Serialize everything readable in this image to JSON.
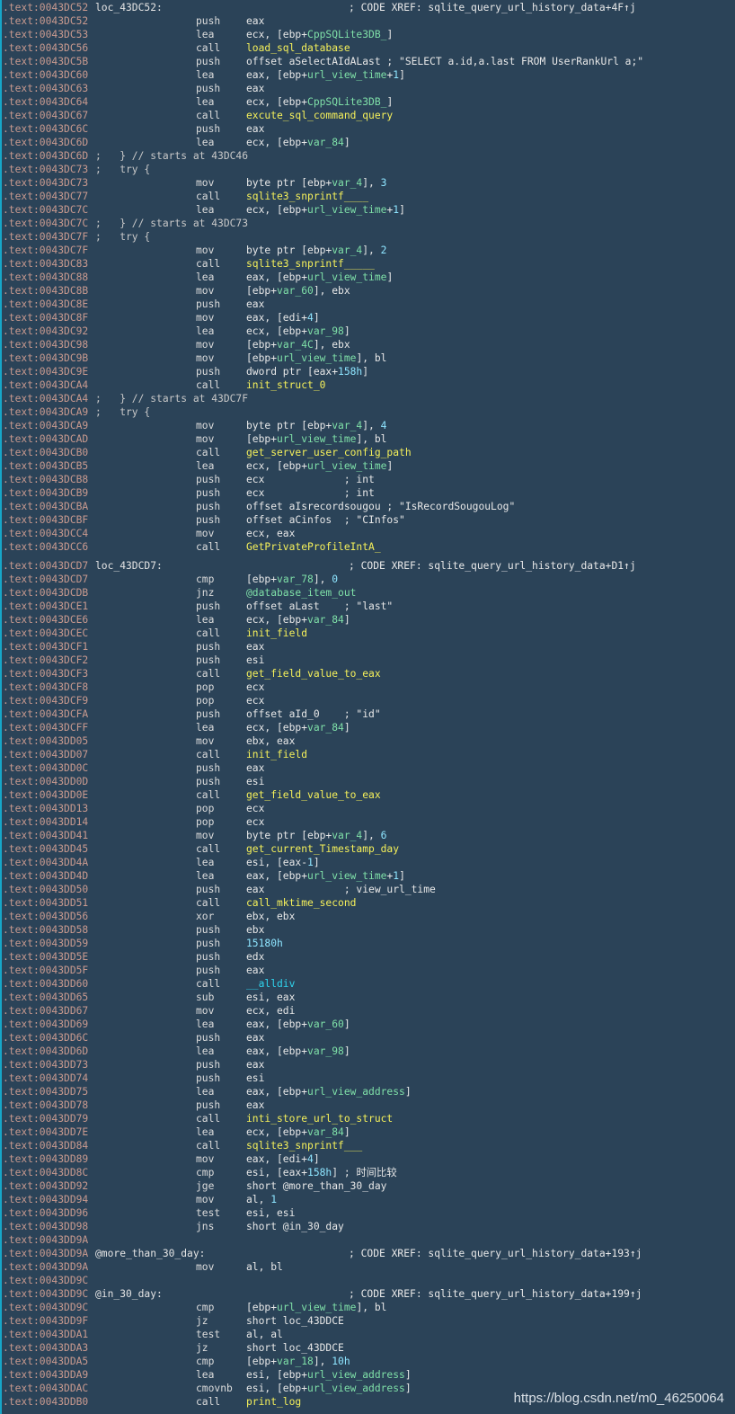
{
  "watermark": "https://blog.csdn.net/m0_46250064",
  "colors": {
    "background": "#2b4358",
    "address": "#c99a8f",
    "function": "#f5f05a",
    "variable": "#7fe0a8",
    "number": "#8ee5ff",
    "library": "#2fd4ee"
  },
  "lines": [
    {
      "addr": ".text:0043DC52",
      "label": "loc_43DC52:",
      "xref": "; CODE XREF: sqlite_query_url_history_data+4F↑j"
    },
    {
      "addr": ".text:0043DC52",
      "m": "push",
      "ops": [
        [
          "eax"
        ]
      ]
    },
    {
      "addr": ".text:0043DC53",
      "m": "lea",
      "ops": [
        [
          "ecx, [ebp+"
        ],
        [
          "CppSQLite3DB_",
          "v"
        ],
        [
          "]"
        ]
      ]
    },
    {
      "addr": ".text:0043DC56",
      "m": "call",
      "ops": [
        [
          "load_sql_database",
          "f"
        ]
      ]
    },
    {
      "addr": ".text:0043DC5B",
      "m": "push",
      "ops": [
        [
          "offset aSelectAIdALast ; \"SELECT a.id,a.last FROM UserRankUrl a;\""
        ]
      ]
    },
    {
      "addr": ".text:0043DC60",
      "m": "lea",
      "ops": [
        [
          "eax, [ebp+"
        ],
        [
          "url_view_time",
          "v"
        ],
        [
          "+"
        ],
        [
          "1",
          "n"
        ],
        [
          "]"
        ]
      ]
    },
    {
      "addr": ".text:0043DC63",
      "m": "push",
      "ops": [
        [
          "eax"
        ]
      ]
    },
    {
      "addr": ".text:0043DC64",
      "m": "lea",
      "ops": [
        [
          "ecx, [ebp+"
        ],
        [
          "CppSQLite3DB_",
          "v"
        ],
        [
          "]"
        ]
      ]
    },
    {
      "addr": ".text:0043DC67",
      "m": "call",
      "ops": [
        [
          "excute_sql_command_query",
          "f"
        ]
      ]
    },
    {
      "addr": ".text:0043DC6C",
      "m": "push",
      "ops": [
        [
          "eax"
        ]
      ]
    },
    {
      "addr": ".text:0043DC6D",
      "m": "lea",
      "ops": [
        [
          "ecx, [ebp+"
        ],
        [
          "var_84",
          "v"
        ],
        [
          "]"
        ]
      ]
    },
    {
      "addr": ".text:0043DC6D",
      "block": ";   } // starts at 43DC46"
    },
    {
      "addr": ".text:0043DC73",
      "block": ";   try {"
    },
    {
      "addr": ".text:0043DC73",
      "m": "mov",
      "ops": [
        [
          "byte ptr [ebp+"
        ],
        [
          "var_4",
          "v"
        ],
        [
          "], "
        ],
        [
          "3",
          "n"
        ]
      ]
    },
    {
      "addr": ".text:0043DC77",
      "m": "call",
      "ops": [
        [
          "sqlite3_snprintf____",
          "f"
        ]
      ]
    },
    {
      "addr": ".text:0043DC7C",
      "m": "lea",
      "ops": [
        [
          "ecx, [ebp+"
        ],
        [
          "url_view_time",
          "v"
        ],
        [
          "+"
        ],
        [
          "1",
          "n"
        ],
        [
          "]"
        ]
      ]
    },
    {
      "addr": ".text:0043DC7C",
      "block": ";   } // starts at 43DC73"
    },
    {
      "addr": ".text:0043DC7F",
      "block": ";   try {"
    },
    {
      "addr": ".text:0043DC7F",
      "m": "mov",
      "ops": [
        [
          "byte ptr [ebp+"
        ],
        [
          "var_4",
          "v"
        ],
        [
          "], "
        ],
        [
          "2",
          "n"
        ]
      ]
    },
    {
      "addr": ".text:0043DC83",
      "m": "call",
      "ops": [
        [
          "sqlite3_snprintf_____",
          "f"
        ]
      ]
    },
    {
      "addr": ".text:0043DC88",
      "m": "lea",
      "ops": [
        [
          "eax, [ebp+"
        ],
        [
          "url_view_time",
          "v"
        ],
        [
          "]"
        ]
      ]
    },
    {
      "addr": ".text:0043DC8B",
      "m": "mov",
      "ops": [
        [
          "[ebp+"
        ],
        [
          "var_60",
          "v"
        ],
        [
          "], ebx"
        ]
      ]
    },
    {
      "addr": ".text:0043DC8E",
      "m": "push",
      "ops": [
        [
          "eax"
        ]
      ]
    },
    {
      "addr": ".text:0043DC8F",
      "m": "mov",
      "ops": [
        [
          "eax, [edi+"
        ],
        [
          "4",
          "n"
        ],
        [
          "]"
        ]
      ]
    },
    {
      "addr": ".text:0043DC92",
      "m": "lea",
      "ops": [
        [
          "ecx, [ebp+"
        ],
        [
          "var_98",
          "v"
        ],
        [
          "]"
        ]
      ]
    },
    {
      "addr": ".text:0043DC98",
      "m": "mov",
      "ops": [
        [
          "[ebp+"
        ],
        [
          "var_4C",
          "v"
        ],
        [
          "], ebx"
        ]
      ]
    },
    {
      "addr": ".text:0043DC9B",
      "m": "mov",
      "ops": [
        [
          "[ebp+"
        ],
        [
          "url_view_time",
          "v"
        ],
        [
          "], bl"
        ]
      ]
    },
    {
      "addr": ".text:0043DC9E",
      "m": "push",
      "ops": [
        [
          "dword ptr [eax+"
        ],
        [
          "158h",
          "n"
        ],
        [
          "]"
        ]
      ]
    },
    {
      "addr": ".text:0043DCA4",
      "m": "call",
      "ops": [
        [
          "init_struct_0",
          "f"
        ]
      ]
    },
    {
      "addr": ".text:0043DCA4",
      "block": ";   } // starts at 43DC7F"
    },
    {
      "addr": ".text:0043DCA9",
      "block": ";   try {"
    },
    {
      "addr": ".text:0043DCA9",
      "m": "mov",
      "ops": [
        [
          "byte ptr [ebp+"
        ],
        [
          "var_4",
          "v"
        ],
        [
          "], "
        ],
        [
          "4",
          "n"
        ]
      ]
    },
    {
      "addr": ".text:0043DCAD",
      "m": "mov",
      "ops": [
        [
          "[ebp+"
        ],
        [
          "url_view_time",
          "v"
        ],
        [
          "], bl"
        ]
      ]
    },
    {
      "addr": ".text:0043DCB0",
      "m": "call",
      "ops": [
        [
          "get_server_user_config_path",
          "f"
        ]
      ]
    },
    {
      "addr": ".text:0043DCB5",
      "m": "lea",
      "ops": [
        [
          "ecx, [ebp+"
        ],
        [
          "url_view_time",
          "v"
        ],
        [
          "]"
        ]
      ]
    },
    {
      "addr": ".text:0043DCB8",
      "m": "push",
      "ops": [
        [
          "ecx             ; int"
        ]
      ]
    },
    {
      "addr": ".text:0043DCB9",
      "m": "push",
      "ops": [
        [
          "ecx             ; int"
        ]
      ]
    },
    {
      "addr": ".text:0043DCBA",
      "m": "push",
      "ops": [
        [
          "offset aIsrecordsougou ; \"IsRecordSougouLog\""
        ]
      ]
    },
    {
      "addr": ".text:0043DCBF",
      "m": "push",
      "ops": [
        [
          "offset aCinfos  ; \"CInfos\""
        ]
      ]
    },
    {
      "addr": ".text:0043DCC4",
      "m": "mov",
      "ops": [
        [
          "ecx, eax"
        ]
      ]
    },
    {
      "addr": ".text:0043DCC6",
      "m": "call",
      "ops": [
        [
          "GetPrivateProfileIntA_",
          "f"
        ]
      ]
    },
    {
      "addr": ".text:0043DCD7",
      "label": "loc_43DCD7:",
      "xref": "; CODE XREF: sqlite_query_url_history_data+D1↑j",
      "gap": true
    },
    {
      "addr": ".text:0043DCD7",
      "m": "cmp",
      "ops": [
        [
          "[ebp+"
        ],
        [
          "var_78",
          "v"
        ],
        [
          "], "
        ],
        [
          "0",
          "n"
        ]
      ]
    },
    {
      "addr": ".text:0043DCDB",
      "m": "jnz",
      "ops": [
        [
          "@database_item_out",
          "v"
        ]
      ]
    },
    {
      "addr": ".text:0043DCE1",
      "m": "push",
      "ops": [
        [
          "offset aLast    ; \"last\""
        ]
      ]
    },
    {
      "addr": ".text:0043DCE6",
      "m": "lea",
      "ops": [
        [
          "ecx, [ebp+"
        ],
        [
          "var_84",
          "v"
        ],
        [
          "]"
        ]
      ]
    },
    {
      "addr": ".text:0043DCEC",
      "m": "call",
      "ops": [
        [
          "init_field",
          "f"
        ]
      ]
    },
    {
      "addr": ".text:0043DCF1",
      "m": "push",
      "ops": [
        [
          "eax"
        ]
      ]
    },
    {
      "addr": ".text:0043DCF2",
      "m": "push",
      "ops": [
        [
          "esi"
        ]
      ]
    },
    {
      "addr": ".text:0043DCF3",
      "m": "call",
      "ops": [
        [
          "get_field_value_to_eax",
          "f"
        ]
      ]
    },
    {
      "addr": ".text:0043DCF8",
      "m": "pop",
      "ops": [
        [
          "ecx"
        ]
      ]
    },
    {
      "addr": ".text:0043DCF9",
      "m": "pop",
      "ops": [
        [
          "ecx"
        ]
      ]
    },
    {
      "addr": ".text:0043DCFA",
      "m": "push",
      "ops": [
        [
          "offset aId_0    ; \"id\""
        ]
      ]
    },
    {
      "addr": ".text:0043DCFF",
      "m": "lea",
      "ops": [
        [
          "ecx, [ebp+"
        ],
        [
          "var_84",
          "v"
        ],
        [
          "]"
        ]
      ]
    },
    {
      "addr": ".text:0043DD05",
      "m": "mov",
      "ops": [
        [
          "ebx, eax"
        ]
      ]
    },
    {
      "addr": ".text:0043DD07",
      "m": "call",
      "ops": [
        [
          "init_field",
          "f"
        ]
      ]
    },
    {
      "addr": ".text:0043DD0C",
      "m": "push",
      "ops": [
        [
          "eax"
        ]
      ]
    },
    {
      "addr": ".text:0043DD0D",
      "m": "push",
      "ops": [
        [
          "esi"
        ]
      ]
    },
    {
      "addr": ".text:0043DD0E",
      "m": "call",
      "ops": [
        [
          "get_field_value_to_eax",
          "f"
        ]
      ]
    },
    {
      "addr": ".text:0043DD13",
      "m": "pop",
      "ops": [
        [
          "ecx"
        ]
      ]
    },
    {
      "addr": ".text:0043DD14",
      "m": "pop",
      "ops": [
        [
          "ecx"
        ]
      ]
    },
    {
      "addr": ".text:0043DD41",
      "m": "mov",
      "ops": [
        [
          "byte ptr [ebp+"
        ],
        [
          "var_4",
          "v"
        ],
        [
          "], "
        ],
        [
          "6",
          "n"
        ]
      ]
    },
    {
      "addr": ".text:0043DD45",
      "m": "call",
      "ops": [
        [
          "get_current_Timestamp_day",
          "f"
        ]
      ]
    },
    {
      "addr": ".text:0043DD4A",
      "m": "lea",
      "ops": [
        [
          "esi, [eax-"
        ],
        [
          "1",
          "n"
        ],
        [
          "]"
        ]
      ]
    },
    {
      "addr": ".text:0043DD4D",
      "m": "lea",
      "ops": [
        [
          "eax, [ebp+"
        ],
        [
          "url_view_time",
          "v"
        ],
        [
          "+"
        ],
        [
          "1",
          "n"
        ],
        [
          "]"
        ]
      ]
    },
    {
      "addr": ".text:0043DD50",
      "m": "push",
      "ops": [
        [
          "eax             ; view_url_time"
        ]
      ]
    },
    {
      "addr": ".text:0043DD51",
      "m": "call",
      "ops": [
        [
          "call_mktime_second",
          "f"
        ]
      ]
    },
    {
      "addr": ".text:0043DD56",
      "m": "xor",
      "ops": [
        [
          "ebx, ebx"
        ]
      ]
    },
    {
      "addr": ".text:0043DD58",
      "m": "push",
      "ops": [
        [
          "ebx"
        ]
      ]
    },
    {
      "addr": ".text:0043DD59",
      "m": "push",
      "ops": [
        [
          "15180h",
          "n"
        ]
      ]
    },
    {
      "addr": ".text:0043DD5E",
      "m": "push",
      "ops": [
        [
          "edx"
        ]
      ]
    },
    {
      "addr": ".text:0043DD5F",
      "m": "push",
      "ops": [
        [
          "eax"
        ]
      ]
    },
    {
      "addr": ".text:0043DD60",
      "m": "call",
      "ops": [
        [
          "__alldiv",
          "s"
        ]
      ]
    },
    {
      "addr": ".text:0043DD65",
      "m": "sub",
      "ops": [
        [
          "esi, eax"
        ]
      ]
    },
    {
      "addr": ".text:0043DD67",
      "m": "mov",
      "ops": [
        [
          "ecx, edi"
        ]
      ]
    },
    {
      "addr": ".text:0043DD69",
      "m": "lea",
      "ops": [
        [
          "eax, [ebp+"
        ],
        [
          "var_60",
          "v"
        ],
        [
          "]"
        ]
      ]
    },
    {
      "addr": ".text:0043DD6C",
      "m": "push",
      "ops": [
        [
          "eax"
        ]
      ]
    },
    {
      "addr": ".text:0043DD6D",
      "m": "lea",
      "ops": [
        [
          "eax, [ebp+"
        ],
        [
          "var_98",
          "v"
        ],
        [
          "]"
        ]
      ]
    },
    {
      "addr": ".text:0043DD73",
      "m": "push",
      "ops": [
        [
          "eax"
        ]
      ]
    },
    {
      "addr": ".text:0043DD74",
      "m": "push",
      "ops": [
        [
          "esi"
        ]
      ]
    },
    {
      "addr": ".text:0043DD75",
      "m": "lea",
      "ops": [
        [
          "eax, [ebp+"
        ],
        [
          "url_view_address",
          "v"
        ],
        [
          "]"
        ]
      ]
    },
    {
      "addr": ".text:0043DD78",
      "m": "push",
      "ops": [
        [
          "eax"
        ]
      ]
    },
    {
      "addr": ".text:0043DD79",
      "m": "call",
      "ops": [
        [
          "inti_store_url_to_struct",
          "f"
        ]
      ]
    },
    {
      "addr": ".text:0043DD7E",
      "m": "lea",
      "ops": [
        [
          "ecx, [ebp+"
        ],
        [
          "var_84",
          "v"
        ],
        [
          "]"
        ]
      ]
    },
    {
      "addr": ".text:0043DD84",
      "m": "call",
      "ops": [
        [
          "sqlite3_snprintf___",
          "f"
        ]
      ]
    },
    {
      "addr": ".text:0043DD89",
      "m": "mov",
      "ops": [
        [
          "eax, [edi+"
        ],
        [
          "4",
          "n"
        ],
        [
          "]"
        ]
      ]
    },
    {
      "addr": ".text:0043DD8C",
      "m": "cmp",
      "ops": [
        [
          "esi, [eax+"
        ],
        [
          "158h",
          "n"
        ],
        [
          "] ; 时间比较"
        ]
      ]
    },
    {
      "addr": ".text:0043DD92",
      "m": "jge",
      "ops": [
        [
          "short @more_than_30_day"
        ]
      ]
    },
    {
      "addr": ".text:0043DD94",
      "m": "mov",
      "ops": [
        [
          "al, "
        ],
        [
          "1",
          "n"
        ]
      ]
    },
    {
      "addr": ".text:0043DD96",
      "m": "test",
      "ops": [
        [
          "esi, esi"
        ]
      ]
    },
    {
      "addr": ".text:0043DD98",
      "m": "jns",
      "ops": [
        [
          "short @in_30_day"
        ]
      ]
    },
    {
      "addr": ".text:0043DD9A"
    },
    {
      "addr": ".text:0043DD9A",
      "label": "@more_than_30_day:",
      "xref": "; CODE XREF: sqlite_query_url_history_data+193↑j"
    },
    {
      "addr": ".text:0043DD9A",
      "m": "mov",
      "ops": [
        [
          "al, bl"
        ]
      ]
    },
    {
      "addr": ".text:0043DD9C"
    },
    {
      "addr": ".text:0043DD9C",
      "label": "@in_30_day:",
      "xref": "; CODE XREF: sqlite_query_url_history_data+199↑j"
    },
    {
      "addr": ".text:0043DD9C",
      "m": "cmp",
      "ops": [
        [
          "[ebp+"
        ],
        [
          "url_view_time",
          "v"
        ],
        [
          "], bl"
        ]
      ]
    },
    {
      "addr": ".text:0043DD9F",
      "m": "jz",
      "ops": [
        [
          "short loc_43DDCE"
        ]
      ]
    },
    {
      "addr": ".text:0043DDA1",
      "m": "test",
      "ops": [
        [
          "al, al"
        ]
      ]
    },
    {
      "addr": ".text:0043DDA3",
      "m": "jz",
      "ops": [
        [
          "short loc_43DDCE"
        ]
      ]
    },
    {
      "addr": ".text:0043DDA5",
      "m": "cmp",
      "ops": [
        [
          "[ebp+"
        ],
        [
          "var_18",
          "v"
        ],
        [
          "], "
        ],
        [
          "10h",
          "n"
        ]
      ]
    },
    {
      "addr": ".text:0043DDA9",
      "m": "lea",
      "ops": [
        [
          "esi, [ebp+"
        ],
        [
          "url_view_address",
          "v"
        ],
        [
          "]"
        ]
      ]
    },
    {
      "addr": ".text:0043DDAC",
      "m": "cmovnb",
      "ops": [
        [
          "esi, [ebp+"
        ],
        [
          "url_view_address",
          "v"
        ],
        [
          "]"
        ]
      ]
    },
    {
      "addr": ".text:0043DDB0",
      "m": "call",
      "ops": [
        [
          "print_log",
          "f"
        ]
      ]
    }
  ]
}
